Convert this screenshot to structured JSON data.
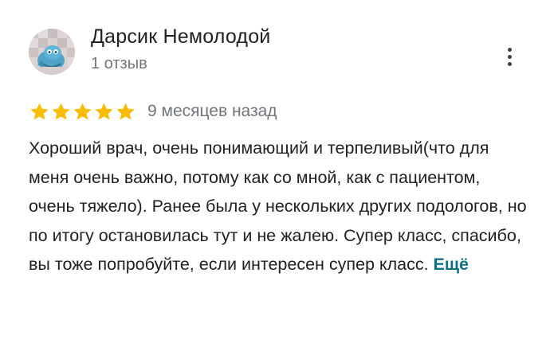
{
  "review": {
    "author": {
      "name": "Дарсик Немолодой",
      "meta": "1 отзыв",
      "avatar_icon": "cartoon-cat-avatar"
    },
    "menu_icon": "more-vert-icon",
    "rating": {
      "stars": 5,
      "max": 5,
      "star_color": "#fbbc04"
    },
    "date": "9 месяцев назад",
    "text": "Хороший врач, очень понимающий и терпеливый(что для меня очень важно, потому как со мной, как с пациентом, очень тяжело). Ранее была у нескольких других подологов, но по итогу остановилась тут и не жалею. Супер класс, спасибо, вы тоже попробуйте, если интересен супер класс.",
    "more_label": "Ещё"
  },
  "colors": {
    "text": "#202124",
    "secondary": "#70757a",
    "link": "#0b7285",
    "star": "#fbbc04"
  }
}
